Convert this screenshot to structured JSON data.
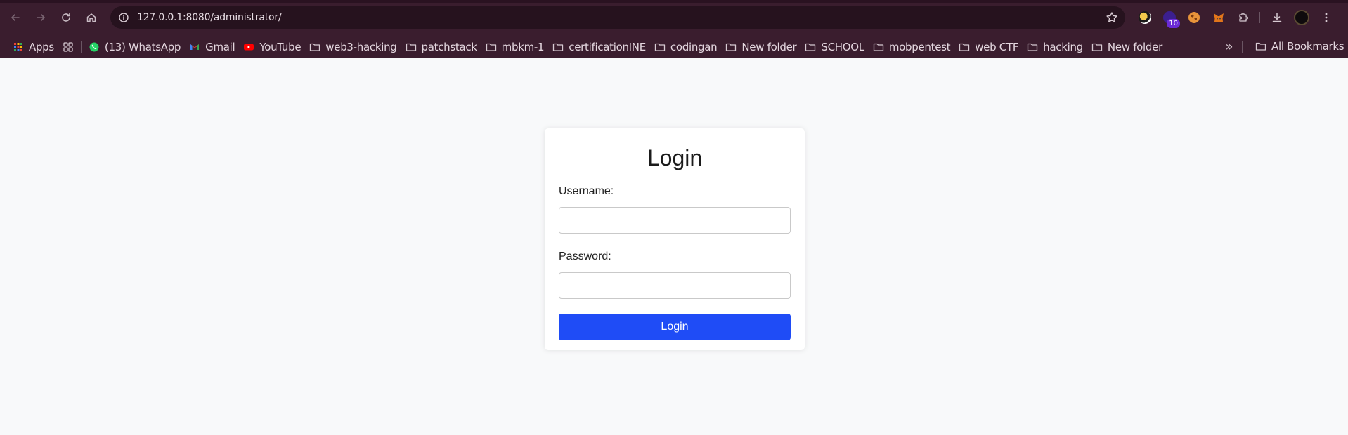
{
  "browser": {
    "url": "127.0.0.1:8080/administrator/",
    "extensions": [
      {
        "name": "extension-1",
        "badge": ""
      },
      {
        "name": "extension-2",
        "badge": "10"
      },
      {
        "name": "cookie-extension",
        "badge": ""
      },
      {
        "name": "metamask-extension",
        "badge": ""
      }
    ],
    "more_bookmarks_glyph": "»"
  },
  "bookmarks": {
    "apps_label": "Apps",
    "items": [
      {
        "label": "(13) WhatsApp",
        "icon": "whatsapp-icon"
      },
      {
        "label": "Gmail",
        "icon": "gmail-icon"
      },
      {
        "label": "YouTube",
        "icon": "youtube-icon"
      },
      {
        "label": "web3-hacking",
        "icon": "folder-icon"
      },
      {
        "label": "patchstack",
        "icon": "folder-icon"
      },
      {
        "label": "mbkm-1",
        "icon": "folder-icon"
      },
      {
        "label": "certificationINE",
        "icon": "folder-icon"
      },
      {
        "label": "codingan",
        "icon": "folder-icon"
      },
      {
        "label": "New folder",
        "icon": "folder-icon"
      },
      {
        "label": "SCHOOL",
        "icon": "folder-icon"
      },
      {
        "label": "mobpentest",
        "icon": "folder-icon"
      },
      {
        "label": "web CTF",
        "icon": "folder-icon"
      },
      {
        "label": "hacking",
        "icon": "folder-icon"
      },
      {
        "label": "New folder",
        "icon": "folder-icon"
      }
    ],
    "all_bookmarks_label": "All Bookmarks"
  },
  "login": {
    "title": "Login",
    "username_label": "Username:",
    "username_value": "",
    "password_label": "Password:",
    "password_value": "",
    "submit_label": "Login"
  },
  "colors": {
    "chrome_bg": "#3a1d2e",
    "omnibox_bg": "#26121e",
    "page_bg": "#f8f9fa",
    "button_bg": "#1f4cf6"
  }
}
